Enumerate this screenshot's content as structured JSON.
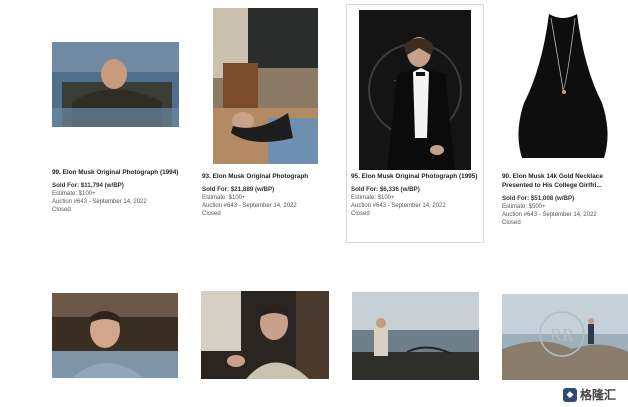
{
  "lots": [
    {
      "title": "99. Elon Musk Original Photograph (1994)",
      "sold": "Sold For: $11,794 (w/BP)",
      "estimate": "Estimate: $100+",
      "auction": "Auction #643 - September 14, 2022",
      "status": "Closed"
    },
    {
      "title": "93. Elon Musk Original Photograph",
      "sold": "Sold For: $21,889 (w/BP)",
      "estimate": "Estimate: $100+",
      "auction": "Auction #643 - September 14, 2022",
      "status": "Closed"
    },
    {
      "title": "95. Elon Musk Original Photograph (1995)",
      "sold": "Sold For: $6,336 (w/BP)",
      "estimate": "Estimate: $100+",
      "auction": "Auction #643 - September 14, 2022",
      "status": "Closed"
    },
    {
      "title": "90. Elon Musk 14k Gold Necklace Presented to His College Girlfri...",
      "sold": "Sold For: $51,008 (w/BP)",
      "estimate": "Estimate: $500+",
      "auction": "Auction #643 - September 14, 2022",
      "status": "Closed"
    }
  ],
  "watermark_text": "RR",
  "watermark_ring": "RARE REMAINS",
  "footer_logo": "格隆汇",
  "icons": [
    "photo-thumbnail",
    "gehui-logo-icon"
  ]
}
